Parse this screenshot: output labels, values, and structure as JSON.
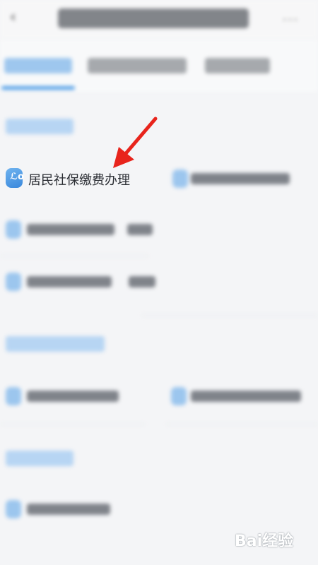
{
  "list": {
    "focused_item_label": "居民社保缴费办理"
  },
  "watermark": {
    "text": "Bai经验"
  },
  "colors": {
    "accent": "#4b9be6",
    "annotation": "#e8241c"
  }
}
